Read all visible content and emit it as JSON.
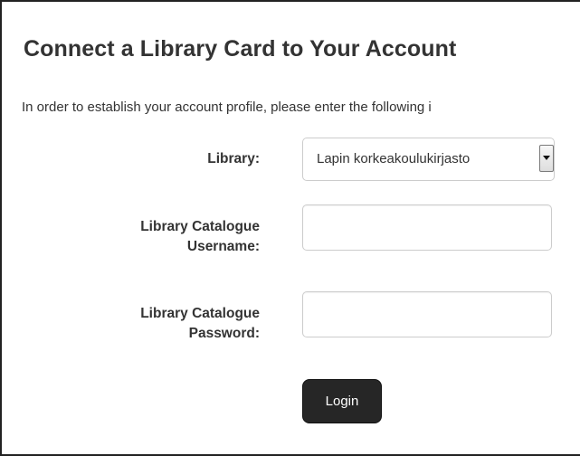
{
  "page": {
    "title": "Connect a Library Card to Your Account",
    "intro": "In order to establish your account profile, please enter the following i"
  },
  "form": {
    "library_label": "Library:",
    "library_selected": "Lapin korkeakoulukirjasto",
    "username_label_line1": "Library Catalogue",
    "username_label_line2": "Username:",
    "username_value": "",
    "password_label_line1": "Library Catalogue",
    "password_label_line2": "Password:",
    "password_value": "",
    "login_label": "Login"
  },
  "icons": {
    "select_arrow": "triangle-down-icon"
  },
  "colors": {
    "text": "#333333",
    "button_background": "#262626",
    "button_text": "#ffffff",
    "input_border": "#cccccc",
    "frame_border": "#222222"
  }
}
